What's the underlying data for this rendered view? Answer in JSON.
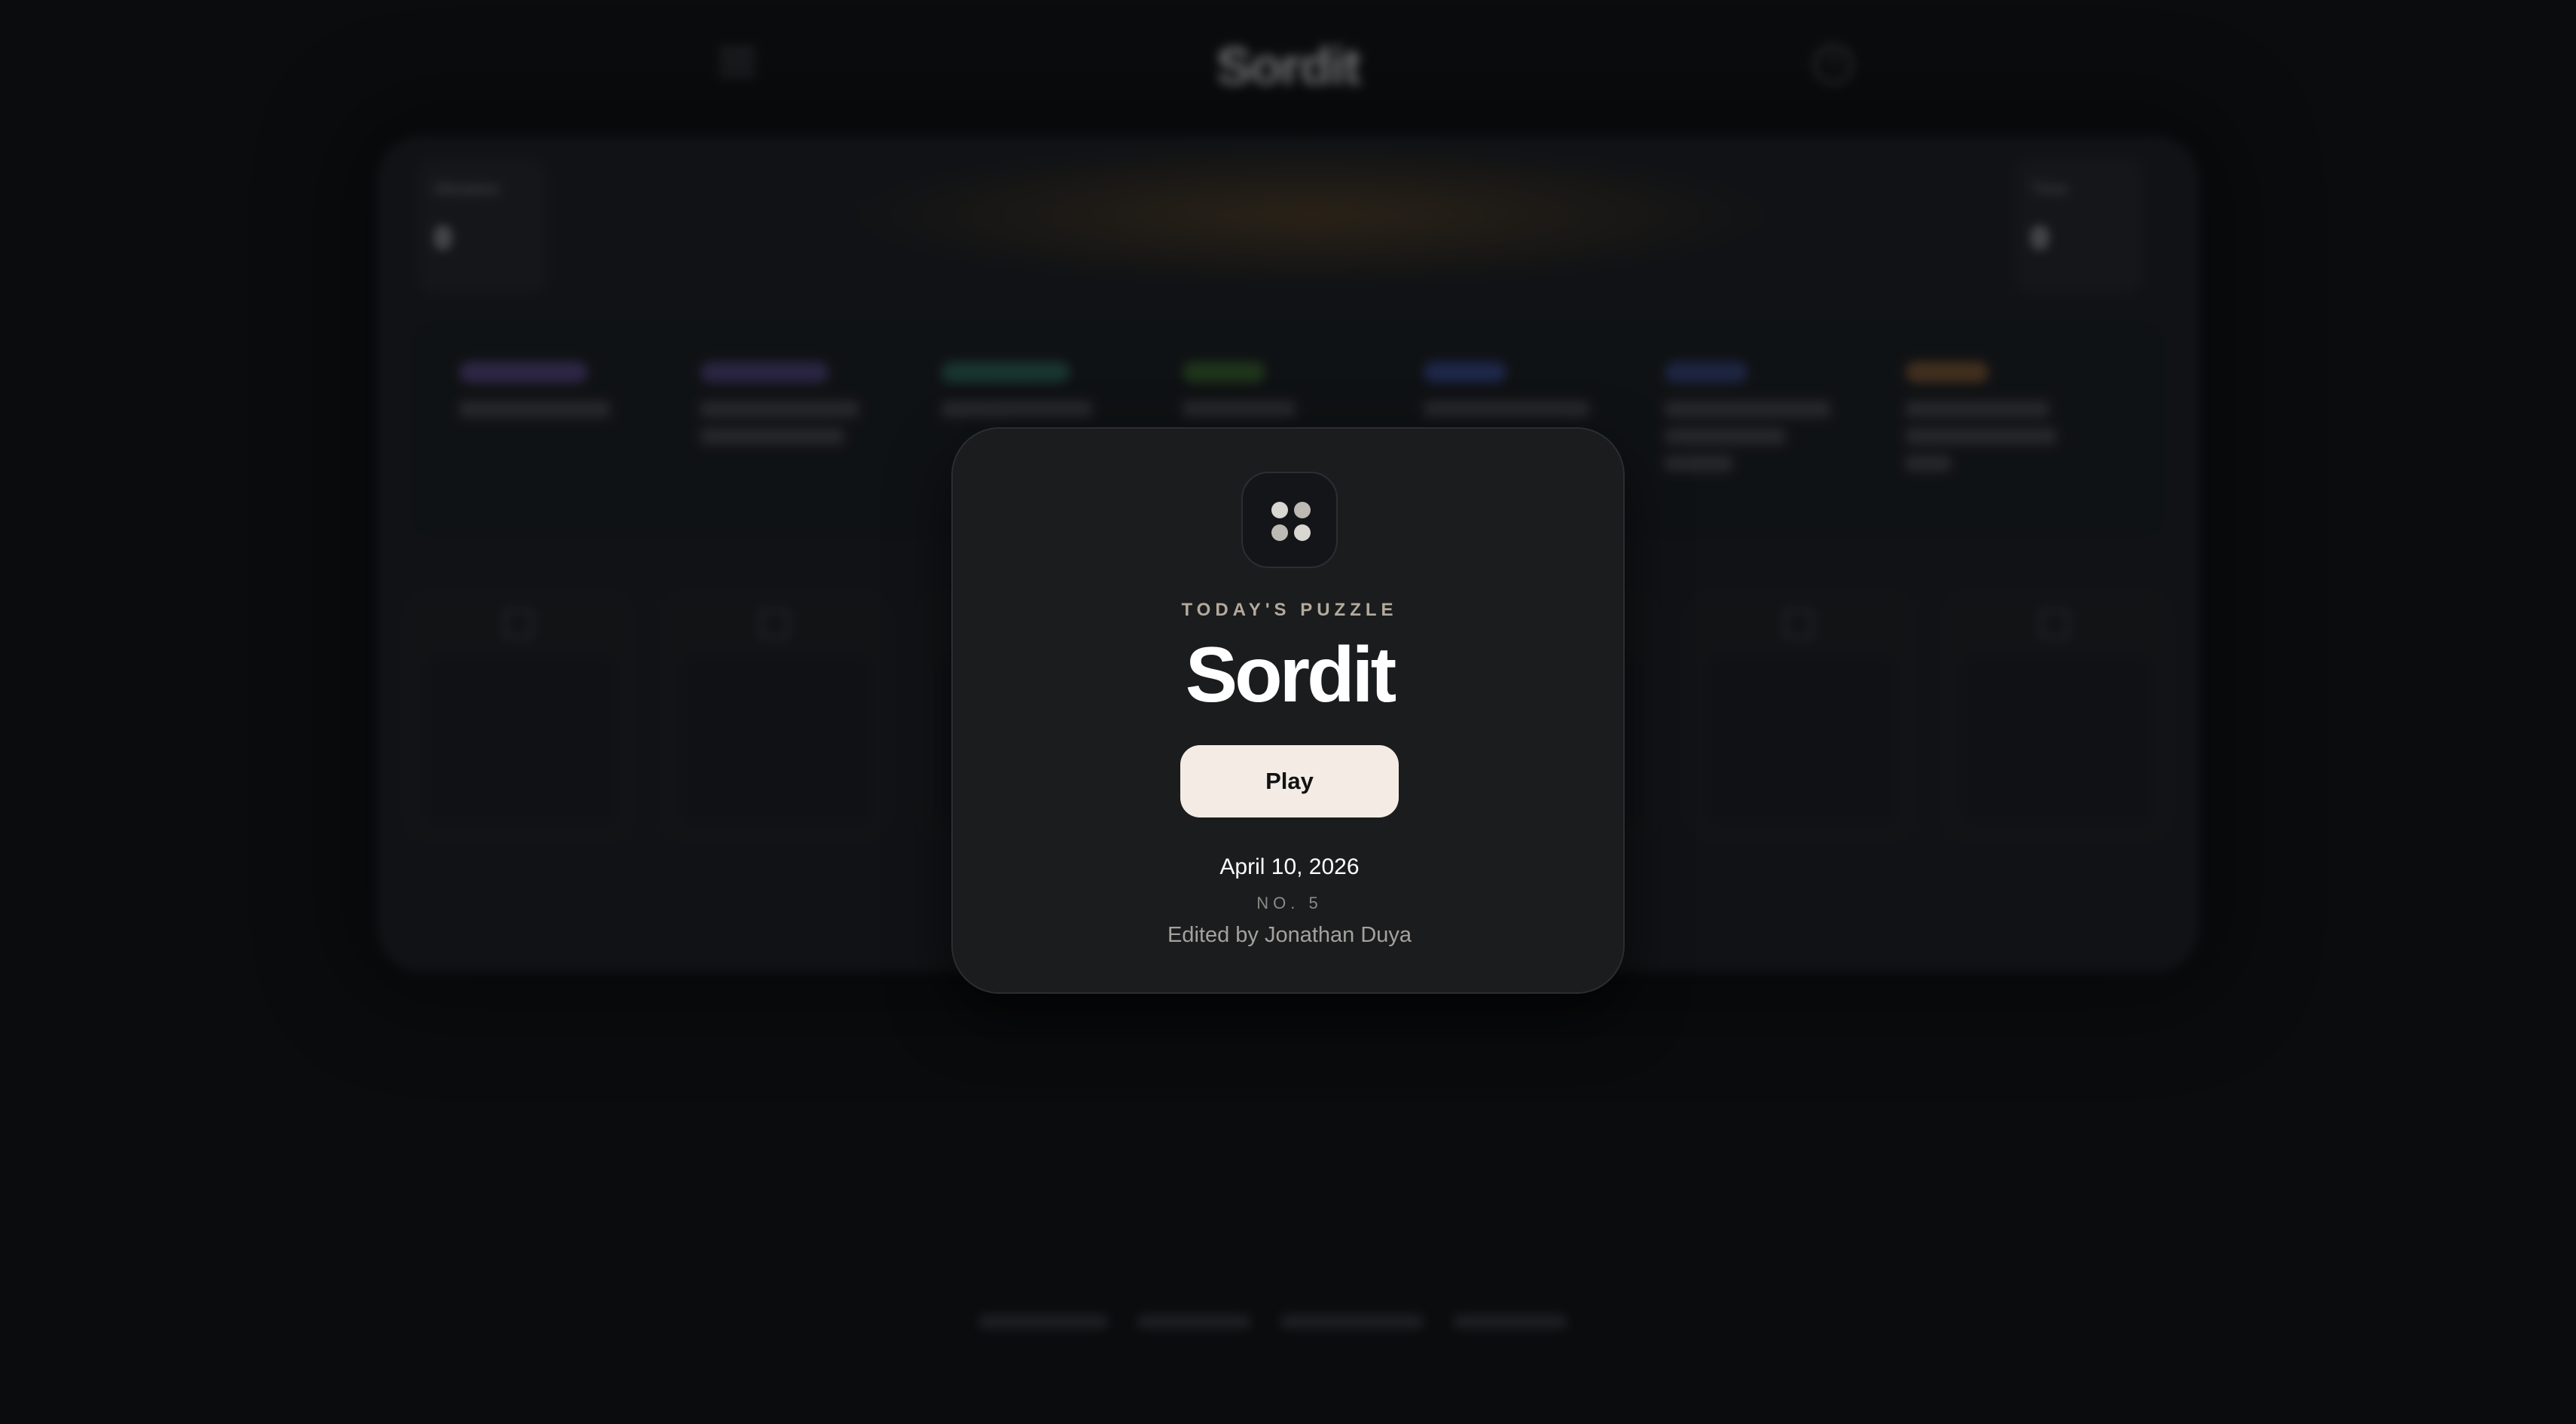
{
  "background": {
    "app_title": "Sordit",
    "stats_left_label": "Mistakes",
    "stats_left_value": "0",
    "stats_right_label": "Time",
    "stats_right_value": "0",
    "category_colors": [
      "#8b6fd6",
      "#7f6bd0",
      "#3fa08a",
      "#4f9a3e",
      "#4a67c9",
      "#4a61b8",
      "#c98a4a"
    ]
  },
  "modal": {
    "icon": "four-dots-grid-icon",
    "eyebrow": "TODAY'S PUZZLE",
    "title": "Sordit",
    "play_label": "Play",
    "date": "April 10, 2026",
    "number": "NO. 5",
    "editor": "Edited by Jonathan Duya"
  },
  "colors": {
    "page_bg": "#0b0c0e",
    "modal_bg": "#1b1c1e",
    "play_bg": "#f4ece4",
    "eyebrow": "#b3aa9d"
  }
}
